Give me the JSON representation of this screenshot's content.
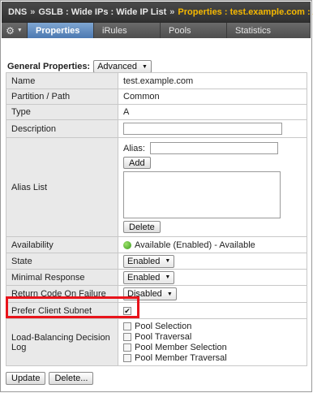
{
  "breadcrumb": {
    "items": [
      "DNS",
      "GSLB : Wide IPs : Wide IP List"
    ],
    "separator": "»",
    "current": "Properties : test.example.com : A"
  },
  "tabs": [
    {
      "label": "Properties",
      "active": true
    },
    {
      "label": "iRules",
      "active": false
    },
    {
      "label": "Pools",
      "active": false
    },
    {
      "label": "Statistics",
      "active": false
    }
  ],
  "general": {
    "label": "General Properties:",
    "mode": "Advanced"
  },
  "rows": {
    "name": {
      "label": "Name",
      "value": "test.example.com"
    },
    "partition": {
      "label": "Partition / Path",
      "value": "Common"
    },
    "type": {
      "label": "Type",
      "value": "A"
    },
    "description": {
      "label": "Description",
      "value": ""
    },
    "alias": {
      "label": "Alias List",
      "field_label": "Alias:",
      "add": "Add",
      "delete": "Delete"
    },
    "availability": {
      "label": "Availability",
      "value": "Available (Enabled) - Available"
    },
    "state": {
      "label": "State",
      "value": "Enabled"
    },
    "minimal": {
      "label": "Minimal Response",
      "value": "Enabled"
    },
    "rcode": {
      "label": "Return Code On Failure",
      "value": "Disabled"
    },
    "ecs": {
      "label": "Prefer Client Subnet",
      "checked": true
    },
    "lbdl": {
      "label": "Load-Balancing Decision Log",
      "options": [
        "Pool Selection",
        "Pool Traversal",
        "Pool Member Selection",
        "Pool Member Traversal"
      ]
    }
  },
  "footer": {
    "update": "Update",
    "delete": "Delete..."
  },
  "colors": {
    "accent": "#f5b800",
    "active_tab": "#4c79b1",
    "highlight": "#e8141b",
    "status": "#3a9a1e"
  }
}
